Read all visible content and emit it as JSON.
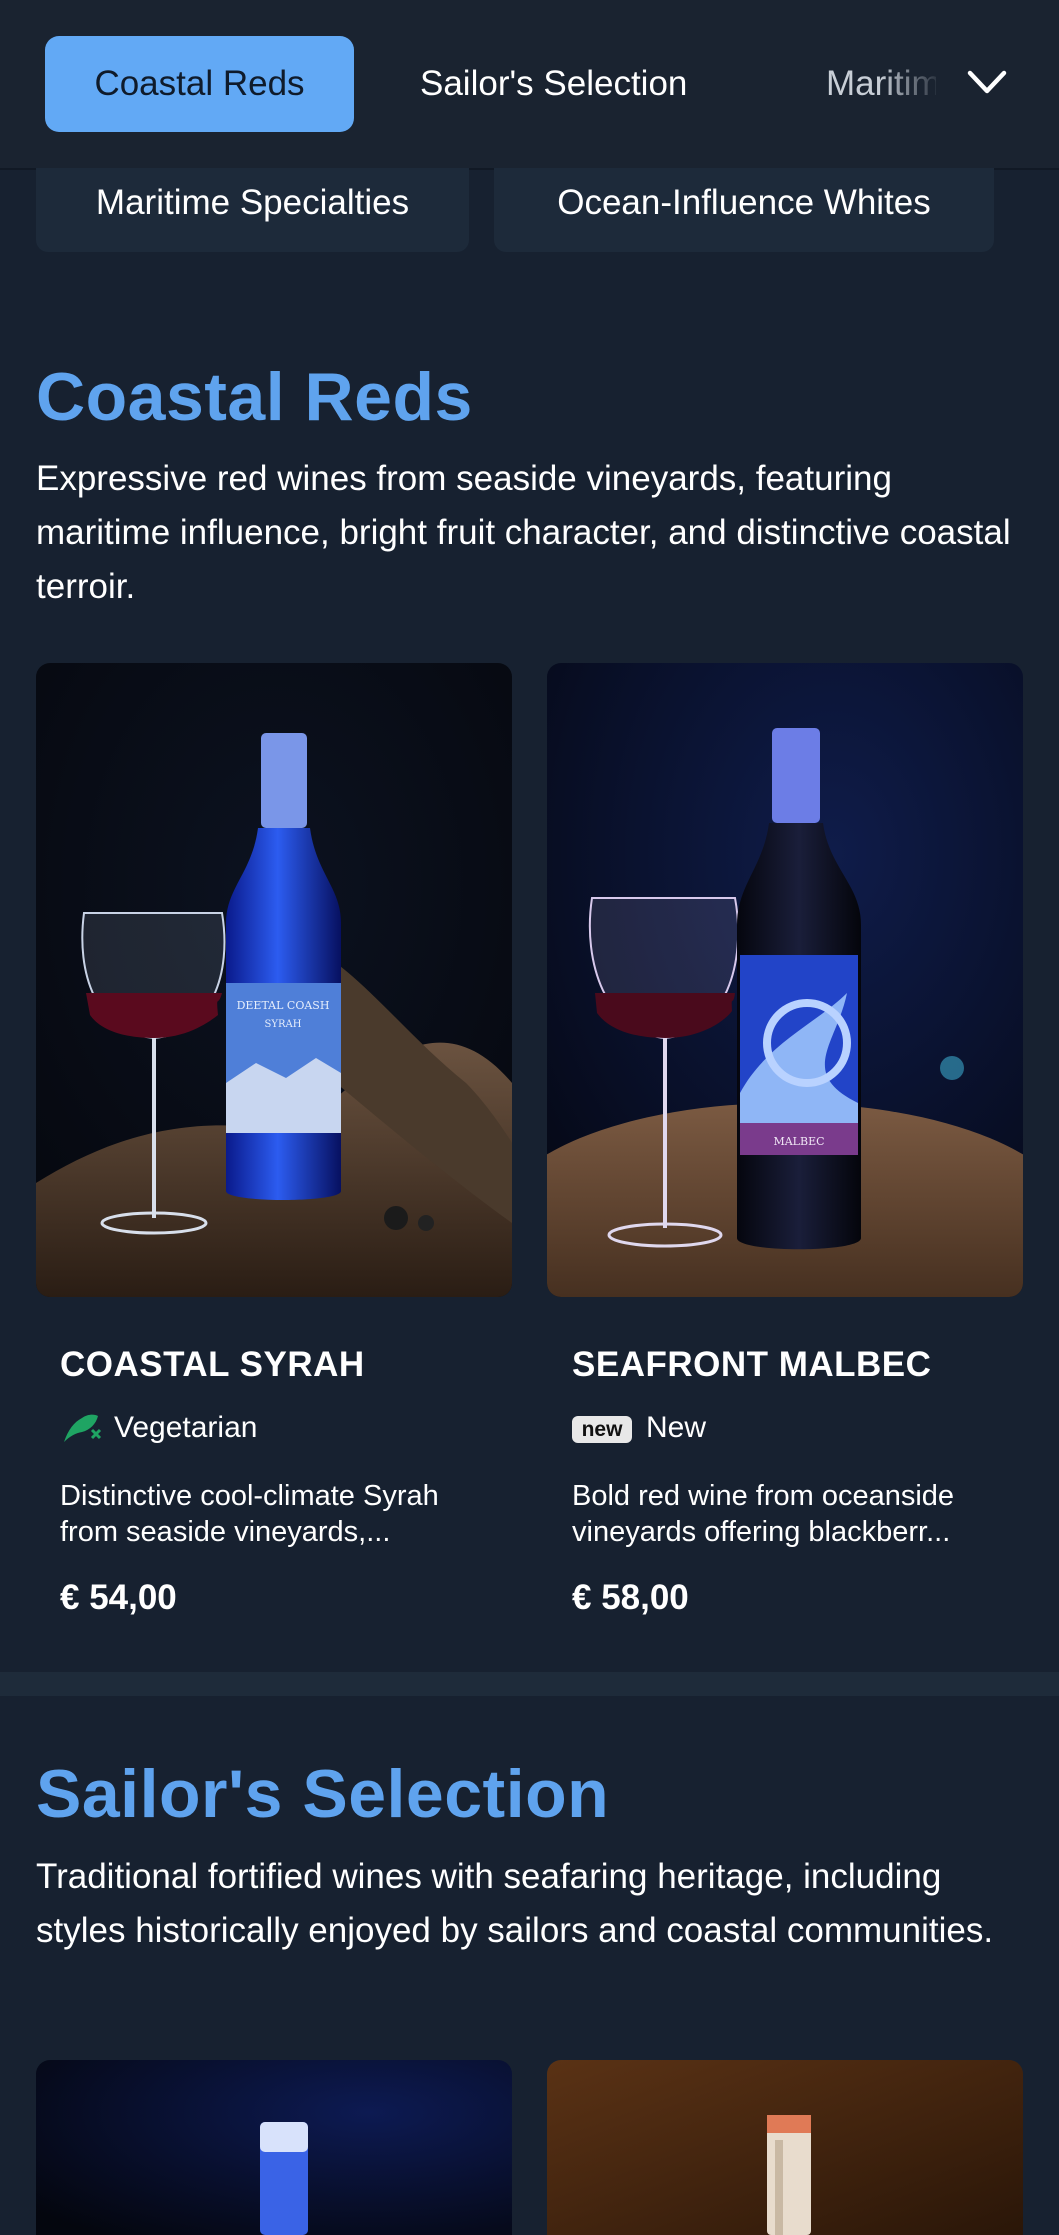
{
  "nav": {
    "tabs": [
      {
        "label": "Coastal Reds"
      },
      {
        "label": "Sailor's Selection"
      },
      {
        "label": "Maritime Specialties"
      }
    ],
    "more_icon": "chevron-down-icon",
    "secondary_tabs": [
      {
        "label": "Maritime Specialties"
      },
      {
        "label": "Ocean-Influence Whites"
      }
    ]
  },
  "sections": [
    {
      "title": "Coastal Reds",
      "description": "Expressive red wines from seaside vineyards, featuring maritime influence, bright fruit character, and distinctive coastal terroir.",
      "products": [
        {
          "name": "COASTAL SYRAH",
          "badge": "Vegetarian",
          "badge_icon": "vegetarian-icon",
          "label_lines": [
            "DEETAL COASH",
            "SYRAH"
          ],
          "description_line1": "Distinctive cool-climate Syrah",
          "description_line2": "from seaside vineyards,...",
          "price": "€ 54,00"
        },
        {
          "name": "SEAFRONT MALBEC",
          "badge_pill": "new",
          "badge": "New",
          "badge_icon": "new-badge-icon",
          "label_lines": [
            "MALBEC"
          ],
          "description_line1": "Bold red wine from oceanside",
          "description_line2": "vineyards offering blackberr...",
          "price": "€ 58,00"
        }
      ]
    },
    {
      "title": "Sailor's Selection",
      "description": "Traditional fortified wines with seafaring heritage, including styles historically enjoyed by sailors and coastal communities."
    }
  ],
  "colors": {
    "background": "#172130",
    "accent": "#62a9f5",
    "heading": "#5fa3ee",
    "vegetarian": "#1fa463"
  }
}
